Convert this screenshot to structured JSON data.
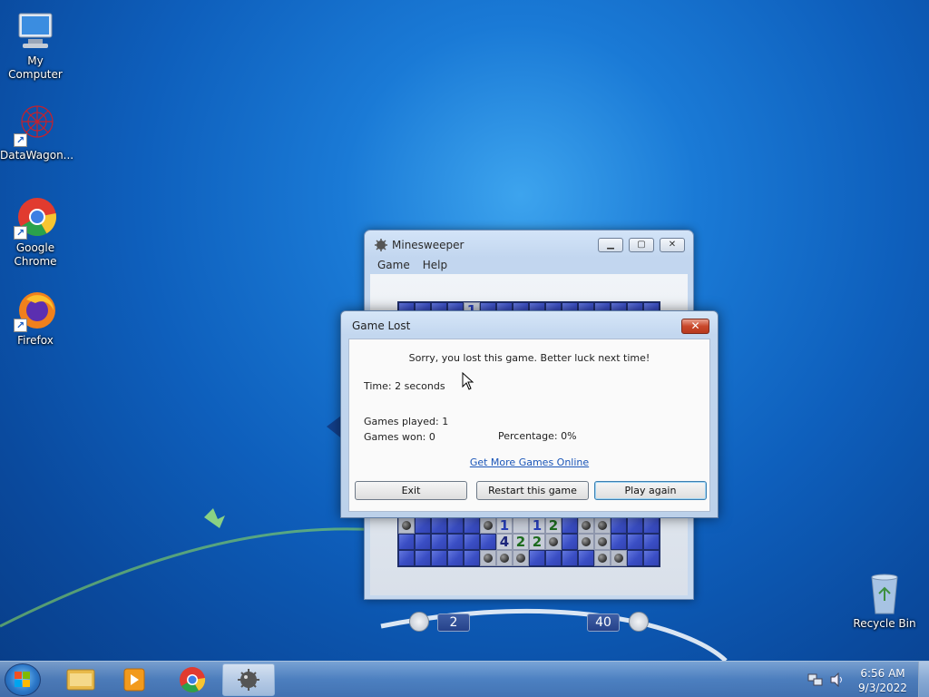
{
  "desktop": {
    "icons": [
      {
        "label": "My Computer",
        "icon": "computer-icon"
      },
      {
        "label": "DataWagon...",
        "icon": "datawagon-icon"
      },
      {
        "label": "Google Chrome",
        "icon": "chrome-icon"
      },
      {
        "label": "Firefox",
        "icon": "firefox-icon"
      },
      {
        "label": "Recycle Bin",
        "icon": "recycle-bin-icon"
      }
    ]
  },
  "minesweeper": {
    "title": "Minesweeper",
    "menu": [
      "Game",
      "Help"
    ],
    "time": "2",
    "mines": "40",
    "visible_rows": [
      [
        "c",
        "c",
        "c",
        "c",
        "1",
        "c",
        "c",
        "c",
        "c",
        "c",
        "c",
        "c",
        "c",
        "c",
        "c",
        "c"
      ],
      [
        "m",
        "c",
        "c",
        "c",
        "c",
        "m",
        "1",
        "",
        "1",
        "2",
        "c",
        "m",
        "m",
        "c",
        "c",
        "c"
      ],
      [
        "c",
        "c",
        "c",
        "c",
        "c",
        "c",
        "4",
        "2",
        "2",
        "m",
        "c",
        "m",
        "m",
        "c",
        "c",
        "c"
      ],
      [
        "c",
        "c",
        "c",
        "c",
        "c",
        "m",
        "m",
        "m",
        "c",
        "c",
        "c",
        "c",
        "m",
        "m",
        "c",
        "c"
      ]
    ]
  },
  "dialog": {
    "title": "Game Lost",
    "message": "Sorry, you lost this game. Better luck next time!",
    "time": "Time: 2 seconds",
    "games_played": "Games played: 1",
    "games_won": "Games won: 0",
    "percentage": "Percentage: 0%",
    "link": "Get More Games Online",
    "buttons": {
      "exit": "Exit",
      "restart": "Restart this game",
      "play_again": "Play again"
    }
  },
  "taskbar": {
    "items": [
      "windows-start-icon",
      "file-explorer-icon",
      "media-player-icon",
      "chrome-icon",
      "minesweeper-icon"
    ],
    "time": "6:56 AM",
    "date": "9/3/2022"
  }
}
